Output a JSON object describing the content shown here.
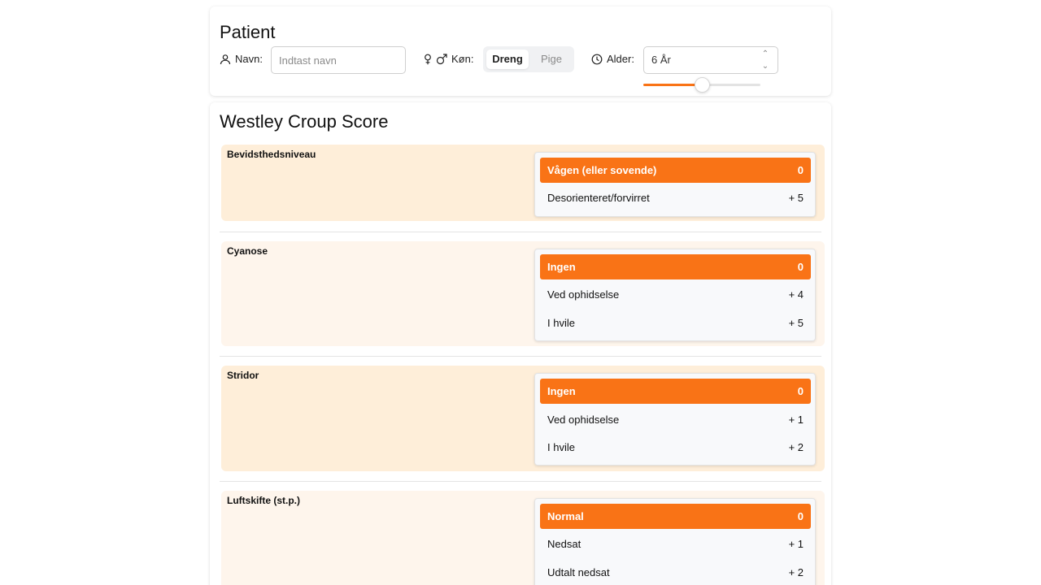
{
  "patient": {
    "title": "Patient",
    "name_label": "Navn:",
    "name_placeholder": "Indtast navn",
    "sex_label": "Køn:",
    "sex_options": [
      "Dreng",
      "Pige"
    ],
    "sex_selected": "Dreng",
    "age_label": "Alder:",
    "age_value": "6 År",
    "age_slider_fraction": 0.5
  },
  "score": {
    "title": "Westley Croup Score",
    "sections": [
      {
        "label": "Bevidsthedsniveau",
        "options": [
          {
            "label": "Vågen (eller sovende)",
            "points": "0",
            "selected": true
          },
          {
            "label": "Desorienteret/forvirret",
            "points": "+ 5",
            "selected": false
          }
        ]
      },
      {
        "label": "Cyanose",
        "options": [
          {
            "label": "Ingen",
            "points": "0",
            "selected": true
          },
          {
            "label": "Ved ophidselse",
            "points": "+ 4",
            "selected": false
          },
          {
            "label": "I hvile",
            "points": "+ 5",
            "selected": false
          }
        ]
      },
      {
        "label": "Stridor",
        "options": [
          {
            "label": "Ingen",
            "points": "0",
            "selected": true
          },
          {
            "label": "Ved ophidselse",
            "points": "+ 1",
            "selected": false
          },
          {
            "label": "I hvile",
            "points": "+ 2",
            "selected": false
          }
        ]
      },
      {
        "label": "Luftskifte (st.p.)",
        "options": [
          {
            "label": "Normal",
            "points": "0",
            "selected": true
          },
          {
            "label": "Nedsat",
            "points": "+ 1",
            "selected": false
          },
          {
            "label": "Udtalt nedsat",
            "points": "+ 2",
            "selected": false
          }
        ]
      }
    ]
  },
  "colors": {
    "accent": "#f97316",
    "section_shade_a": "#feeed9",
    "section_shade_b": "#fef5ec"
  }
}
